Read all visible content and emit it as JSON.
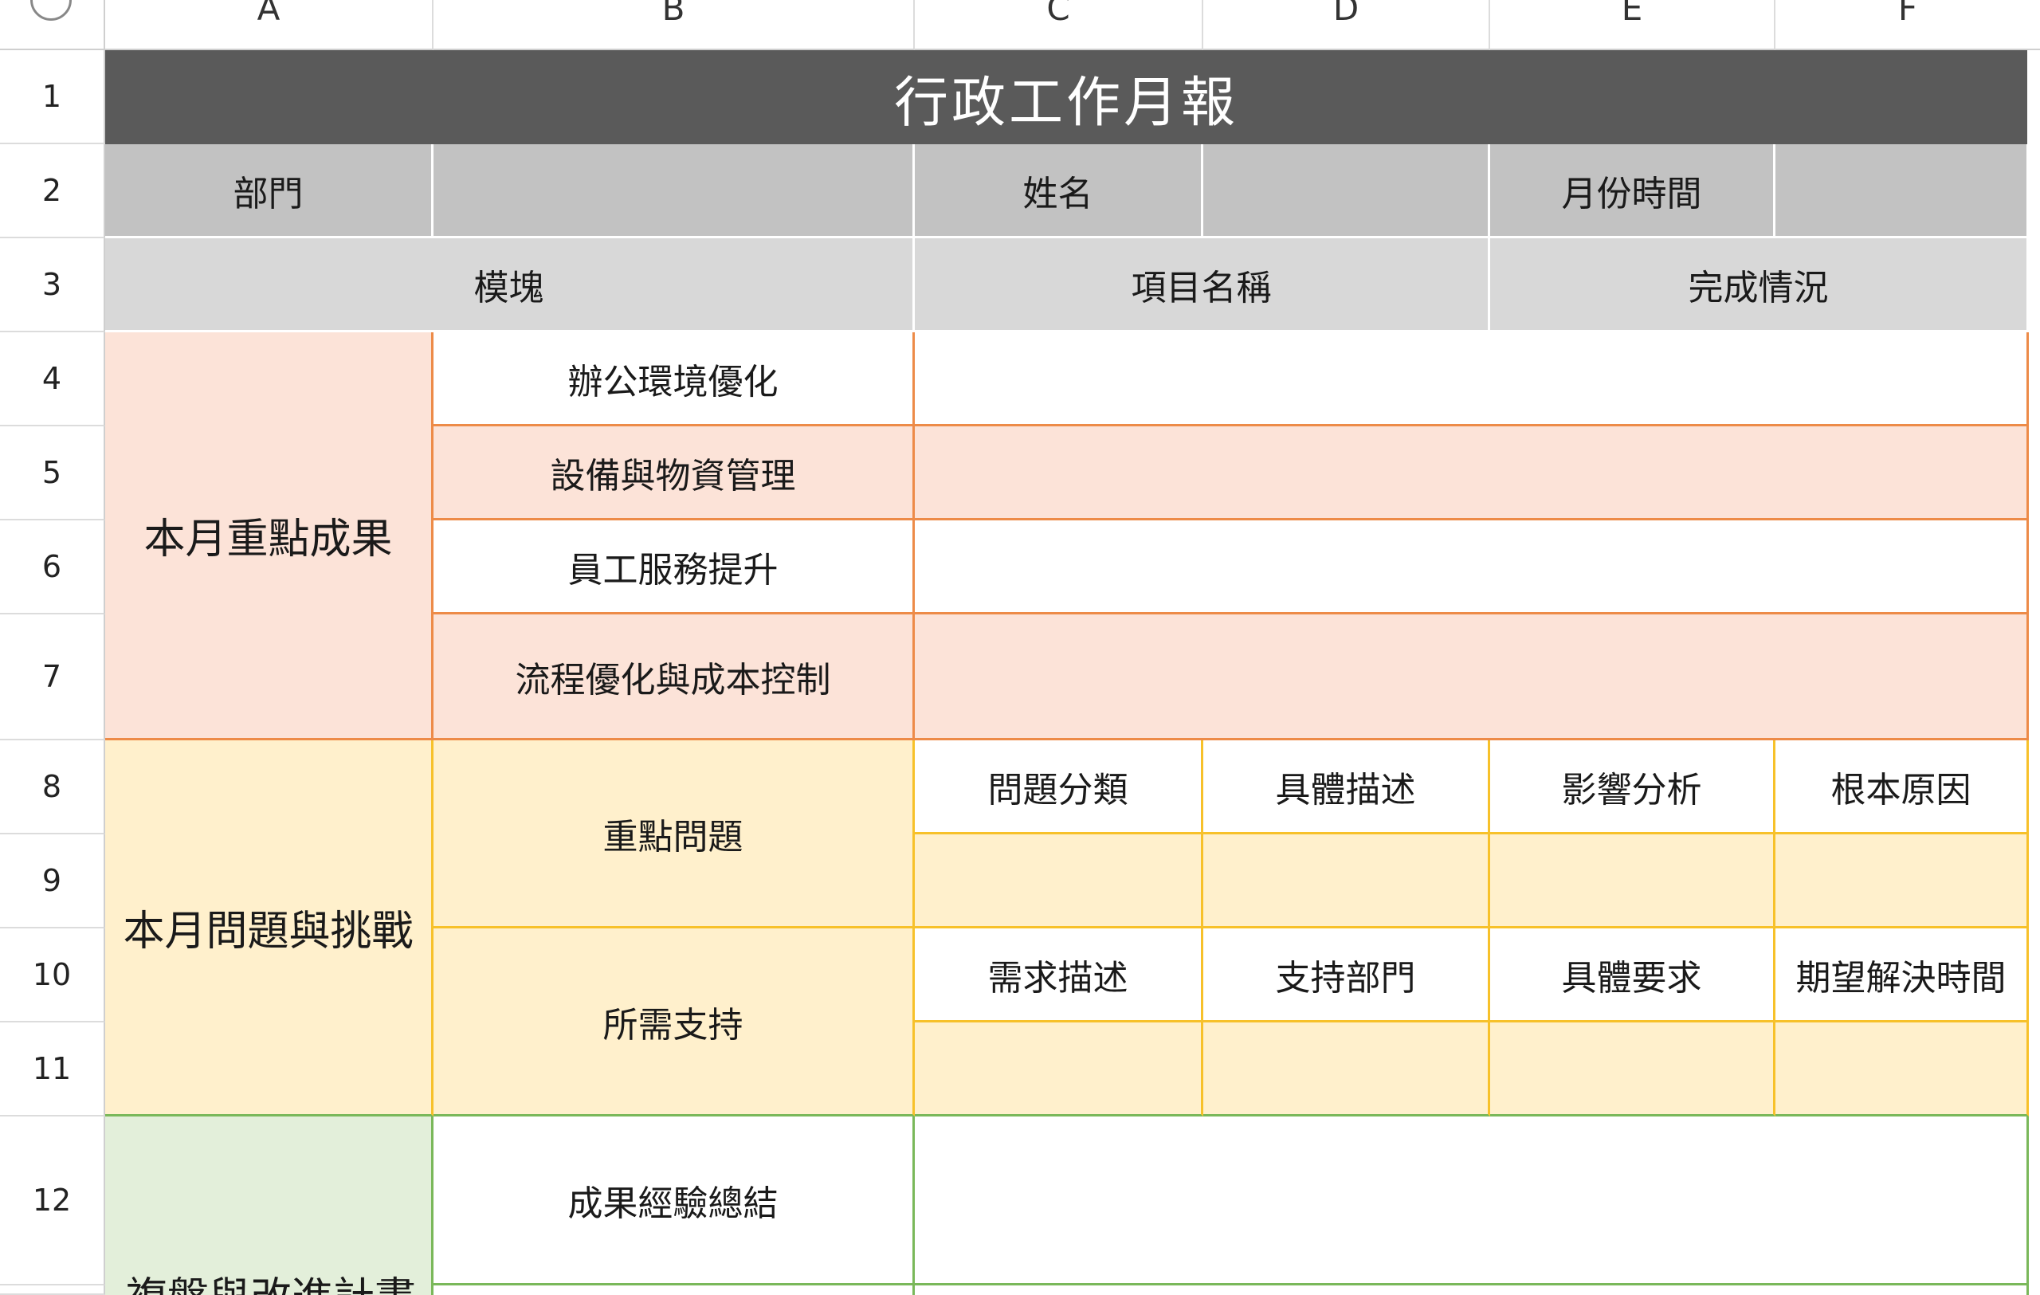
{
  "columns": [
    "A",
    "B",
    "C",
    "D",
    "E",
    "F"
  ],
  "rows": [
    "1",
    "2",
    "3",
    "4",
    "5",
    "6",
    "7",
    "8",
    "9",
    "10",
    "11",
    "12"
  ],
  "title": "行政工作月報",
  "header": {
    "dept_label": "部門",
    "dept_value": "",
    "name_label": "姓名",
    "name_value": "",
    "month_label": "月份時間",
    "month_value": ""
  },
  "col_headers": {
    "module": "模塊",
    "item_name": "項目名稱",
    "status": "完成情況"
  },
  "achievements": {
    "label": "本月重點成果",
    "items": [
      "辦公環境優化",
      "設備與物資管理",
      "員工服務提升",
      "流程優化與成本控制"
    ]
  },
  "issues": {
    "label": "本月問題與挑戰",
    "key_issue": {
      "label": "重點問題",
      "columns": [
        "問題分類",
        "具體描述",
        "影響分析",
        "根本原因"
      ]
    },
    "support": {
      "label": "所需支持",
      "columns": [
        "需求描述",
        "支持部門",
        "具體要求",
        "期望解決時間"
      ]
    }
  },
  "review": {
    "label": "複盤與改進計畫",
    "items": [
      "成果經驗總結"
    ]
  }
}
